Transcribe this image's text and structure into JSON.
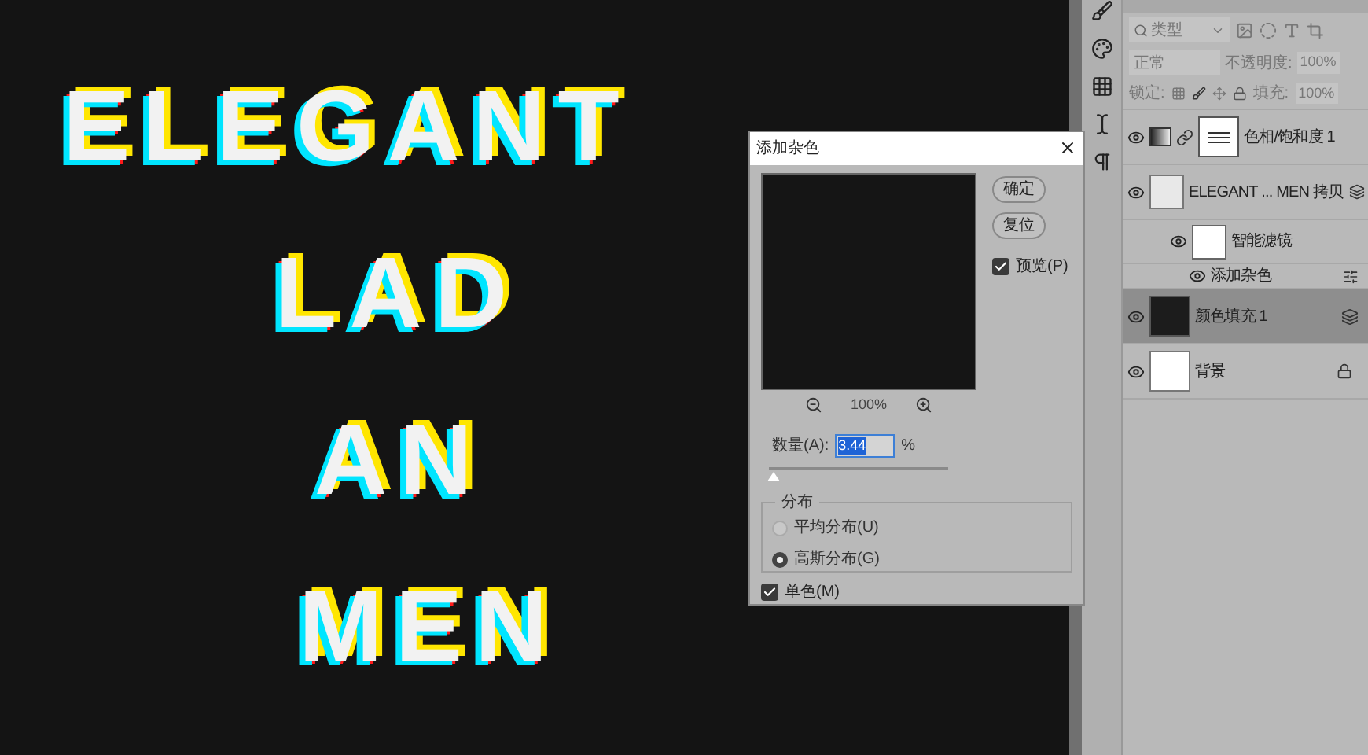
{
  "canvas": {
    "lines": [
      "ELEGANT",
      "LAD",
      "AN",
      "MEN"
    ]
  },
  "layers_panel": {
    "filter": "类型",
    "blend_mode": "正常",
    "opacity_label": "不透明度:",
    "opacity": "100%",
    "lock_label": "锁定:",
    "fill_label": "填充:",
    "fill": "100%",
    "layers": [
      {
        "kind": "adjustment",
        "name": "色相/饱和度 1",
        "visible": true,
        "selected": false
      },
      {
        "kind": "smart",
        "name": "ELEGANT ... MEN 拷贝",
        "visible": true,
        "selected": false
      },
      {
        "kind": "filter_group",
        "name": "智能滤镜",
        "visible": true,
        "selected": false
      },
      {
        "kind": "filter",
        "name": "添加杂色",
        "visible": true,
        "selected": false
      },
      {
        "kind": "fill",
        "name": "颜色填充 1",
        "visible": true,
        "selected": true
      },
      {
        "kind": "background",
        "name": "背景",
        "visible": true,
        "selected": false
      }
    ]
  },
  "dialog": {
    "title": "添加杂色",
    "buttons": [
      "确定",
      "复位"
    ],
    "preview": {
      "label": "预览(P)",
      "checked": true
    },
    "zoom": "100%",
    "amount": {
      "label": "数量(A):",
      "value": "3.44",
      "unit": "%",
      "level": 0.03
    },
    "distribution": {
      "title": "分布",
      "options": [
        {
          "label": "平均分布(U)",
          "selected": false
        },
        {
          "label": "高斯分布(G)",
          "selected": true
        }
      ]
    },
    "monochrome": {
      "label": "单色(M)",
      "checked": true
    }
  }
}
